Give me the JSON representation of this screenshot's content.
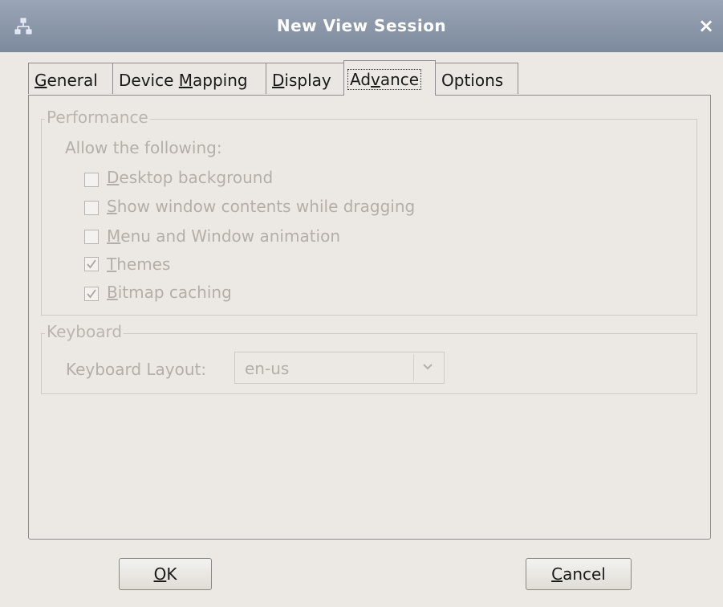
{
  "window": {
    "title": "New View Session",
    "close_glyph": "×",
    "icon": "network-icon"
  },
  "tabs": [
    {
      "label": "General",
      "mnemonic": "G",
      "rest": "eneral",
      "active": false
    },
    {
      "label": "Device Mapping",
      "pre": "Device ",
      "mnemonic": "M",
      "rest": "apping",
      "active": false
    },
    {
      "label": "Display",
      "mnemonic": "D",
      "rest": "isplay",
      "active": false
    },
    {
      "label": "Advance",
      "pre": "Ad",
      "mnemonic": "v",
      "rest": "ance",
      "active": true
    },
    {
      "label": "Options",
      "active": false
    }
  ],
  "performance": {
    "title": "Performance",
    "allow_label": "Allow the following:",
    "options": [
      {
        "label": "Desktop background",
        "mnemonic": "D",
        "rest": "esktop background",
        "checked": false
      },
      {
        "label": "Show window contents while dragging",
        "mnemonic": "S",
        "rest": "how window contents while dragging",
        "checked": false
      },
      {
        "label": "Menu and Window animation",
        "mnemonic": "M",
        "rest": "enu and Window animation",
        "checked": false
      },
      {
        "label": "Themes",
        "mnemonic": "T",
        "rest": "hemes",
        "checked": true
      },
      {
        "label": "Bitmap caching",
        "mnemonic": "B",
        "rest": "itmap caching",
        "checked": true
      }
    ]
  },
  "keyboard": {
    "title": "Keyboard",
    "layout_label": "Keyboard Layout:",
    "layout_value": "en-us"
  },
  "buttons": {
    "ok": {
      "mnemonic": "O",
      "rest": "K"
    },
    "cancel": {
      "mnemonic": "C",
      "rest": "ancel"
    }
  },
  "colors": {
    "titlebar": "#8b97a9",
    "background": "#ece9e4",
    "disabled_text": "#b3afa8"
  }
}
